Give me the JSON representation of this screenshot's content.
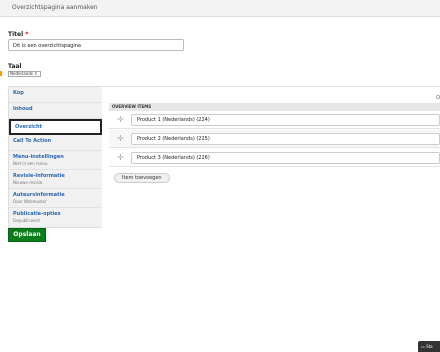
{
  "header": {
    "title": "Overzichtspagina aanmaken"
  },
  "form": {
    "title_label": "Titel",
    "required_marker": "*",
    "title_value": "Dit is een overzichtspagina",
    "lang_label": "Taal",
    "lang_value": "Nederlands ⇕"
  },
  "sidebar": {
    "items": [
      {
        "label": "Kop",
        "sub": ""
      },
      {
        "label": "Inhoud",
        "sub": ""
      },
      {
        "label": "Overzicht",
        "sub": ""
      },
      {
        "label": "Call To Action",
        "sub": ""
      },
      {
        "label": "Menu-instellingen",
        "sub": "Niet in een menu"
      },
      {
        "label": "Revisie-informatie",
        "sub": "Nieuwe revisie"
      },
      {
        "label": "Auteursinformatie",
        "sub": "Door Webmaster"
      },
      {
        "label": "Publicatie-opties",
        "sub": "Gepubliceerd"
      }
    ]
  },
  "overview": {
    "corner_text": "O",
    "header": "OVERVIEW ITEMS",
    "items": [
      "Product 1 (Nederlands) (224)",
      "Product 2 (Nederlands) (225)",
      "Product 3 (Nederlands) (226)"
    ],
    "add_label": "Item toevoegen"
  },
  "actions": {
    "save_label": "Opslaan"
  },
  "status": {
    "label": "Sta"
  },
  "colors": {
    "accent": "#2a67b1",
    "save": "#0a7c1a",
    "required": "#e00000",
    "warning": "#f1a000"
  }
}
